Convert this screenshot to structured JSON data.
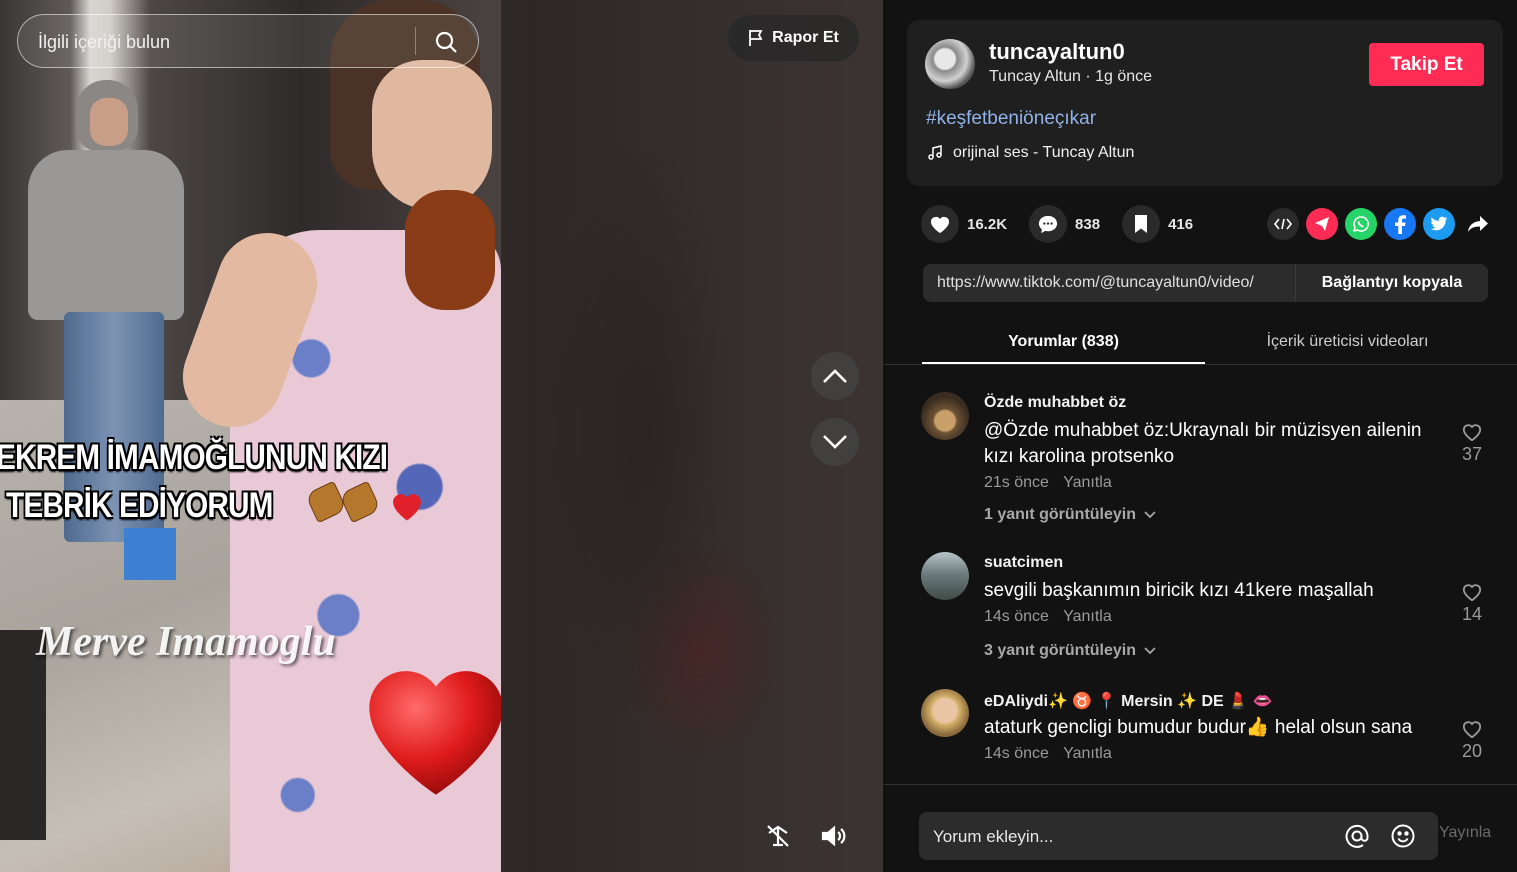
{
  "search": {
    "placeholder": "İlgili içeriği bulun",
    "icon": "search-icon"
  },
  "video": {
    "report_label": "Rapor Et",
    "overlay_line1": "EKREM İMAMOĞLUNUN KIZI",
    "overlay_line2": "TEBRİK EDİYORUM",
    "watermark": "Merve Imamoglu",
    "controls": {
      "up": "chevron-up-icon",
      "down": "chevron-down-icon",
      "pip": "mini-player-icon",
      "volume": "volume-icon"
    }
  },
  "post": {
    "username": "tuncayaltun0",
    "display_name": "Tuncay Altun",
    "separator": " · ",
    "time": "1g önce",
    "follow_label": "Takip Et",
    "hashtag": "#keşfetbeniöneçıkar",
    "music": "orijinal ses - Tuncay Altun"
  },
  "stats": {
    "likes": "16.2K",
    "comments": "838",
    "saves": "416"
  },
  "share_icons": [
    "embed-icon",
    "telegram-icon",
    "whatsapp-icon",
    "facebook-icon",
    "twitter-icon",
    "share-arrow-icon"
  ],
  "colors": {
    "accent": "#fe2c55",
    "hashtag": "#8fb3e8",
    "panel": "#121212",
    "card": "#1f1f1f",
    "telegram": "#fe2c55",
    "whatsapp": "#25d366",
    "facebook": "#1877f2",
    "twitter": "#1d9bf0"
  },
  "link": {
    "url": "https://www.tiktok.com/@tuncayaltun0/video/",
    "copy_label": "Bağlantıyı kopyala"
  },
  "tabs": [
    {
      "label": "Yorumlar (838)"
    },
    {
      "label": "İçerik üreticisi videoları"
    }
  ],
  "comments": [
    {
      "name": "Özde muhabbet öz",
      "text": "@Özde muhabbet öz:Ukraynalı bir müzisyen ailenin kızı karolina protsenko",
      "time": "21s önce",
      "reply": "Yanıtla",
      "view_replies": "1 yanıt görüntüleyin",
      "likes": "37"
    },
    {
      "name": "suatcimen",
      "text": "sevgili başkanımın biricik kızı 41kere maşallah",
      "time": "14s önce",
      "reply": "Yanıtla",
      "view_replies": "3 yanıt görüntüleyin",
      "likes": "14"
    },
    {
      "name": "eDAliydi✨ ♉ 📍 Mersin ✨ DE 💄 👄",
      "text": "ataturk gencligi bumudur budur👍 helal olsun sana",
      "time": "14s önce",
      "reply": "Yanıtla",
      "view_replies": "",
      "likes": "20"
    }
  ],
  "comment_box": {
    "placeholder": "Yorum ekleyin...",
    "post_label": "Yayınla",
    "mention_icon": "at-icon",
    "emoji_icon": "emoji-icon"
  }
}
